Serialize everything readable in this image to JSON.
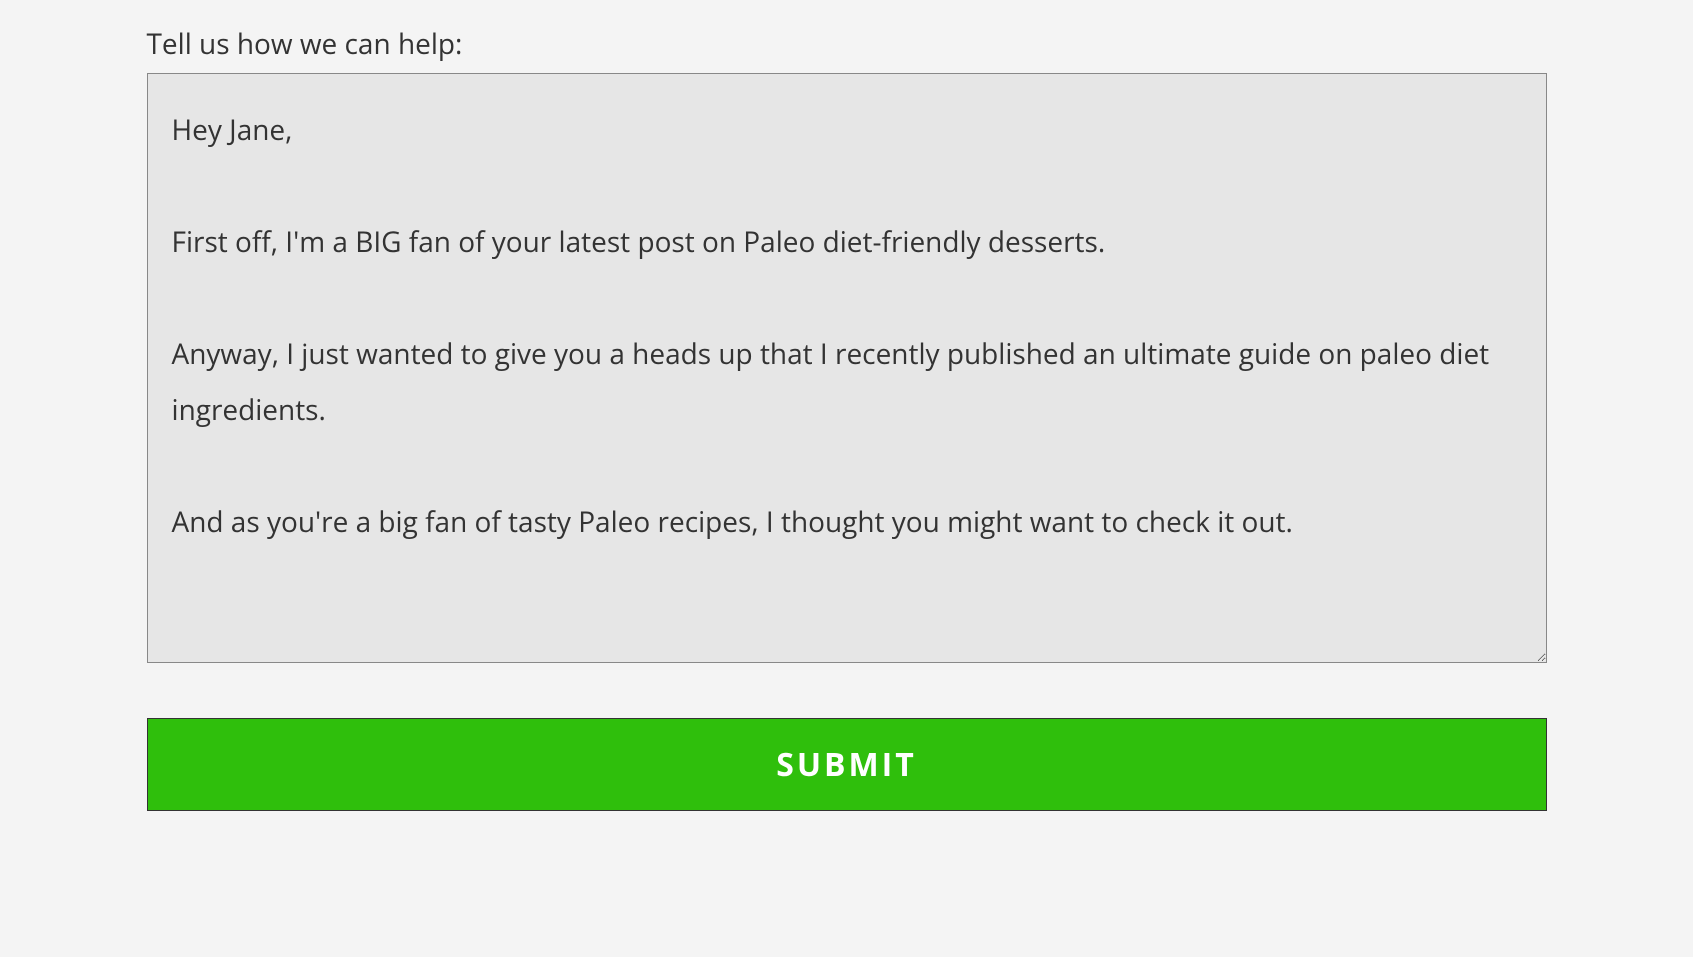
{
  "form": {
    "label": "Tell us how we can help:",
    "message_value": "Hey Jane,\n\nFirst off, I'm a BIG fan of your latest post on Paleo diet-friendly desserts.\n\nAnyway, I just wanted to give you a heads up that I recently published an ultimate guide on paleo diet ingredients.\n\nAnd as you're a big fan of tasty Paleo recipes, I thought you might want to check it out.",
    "submit_label": "SUBMIT"
  },
  "colors": {
    "background": "#f4f4f4",
    "textarea_bg": "#e6e6e6",
    "button_bg": "#2fbf0c",
    "button_text": "#ffffff",
    "text": "#333333"
  }
}
